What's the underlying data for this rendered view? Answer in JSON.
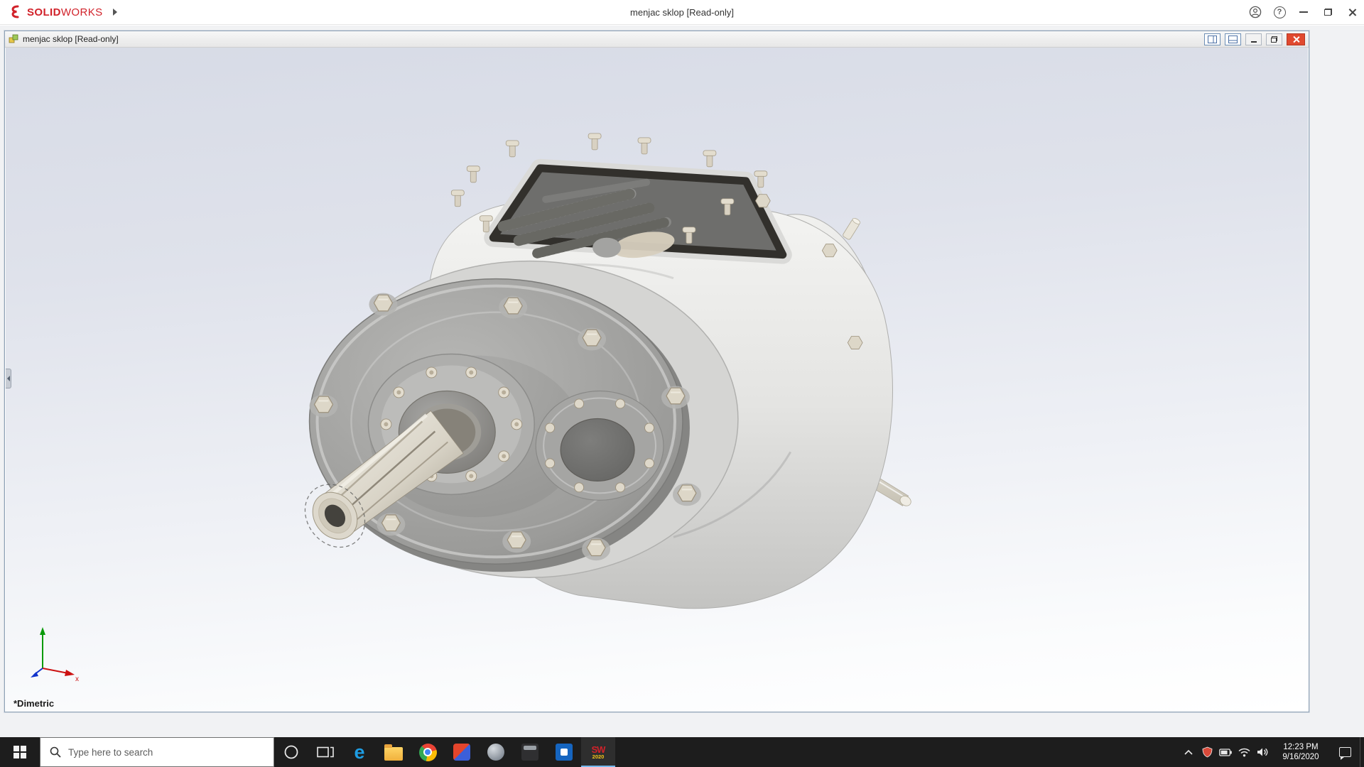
{
  "app": {
    "brand_bold": "SOLID",
    "brand_light": "WORKS",
    "title": "menjac sklop [Read-only]",
    "help_glyph": "?"
  },
  "doc": {
    "title": "menjac sklop [Read-only]",
    "view_orientation": "*Dimetric",
    "triad_x": "x"
  },
  "taskbar": {
    "search_placeholder": "Type here to search",
    "edge_glyph": "e",
    "sw_glyph": "SW",
    "sw_year": "2020",
    "time": "12:23 PM",
    "date": "9/16/2020"
  },
  "colors": {
    "brand_red": "#d1222a",
    "close_red": "#e0492f",
    "taskbar_bg": "#1d1d1d",
    "viewport_gradient_top": "#d7dbe6",
    "viewport_gradient_bottom": "#ffffff"
  }
}
